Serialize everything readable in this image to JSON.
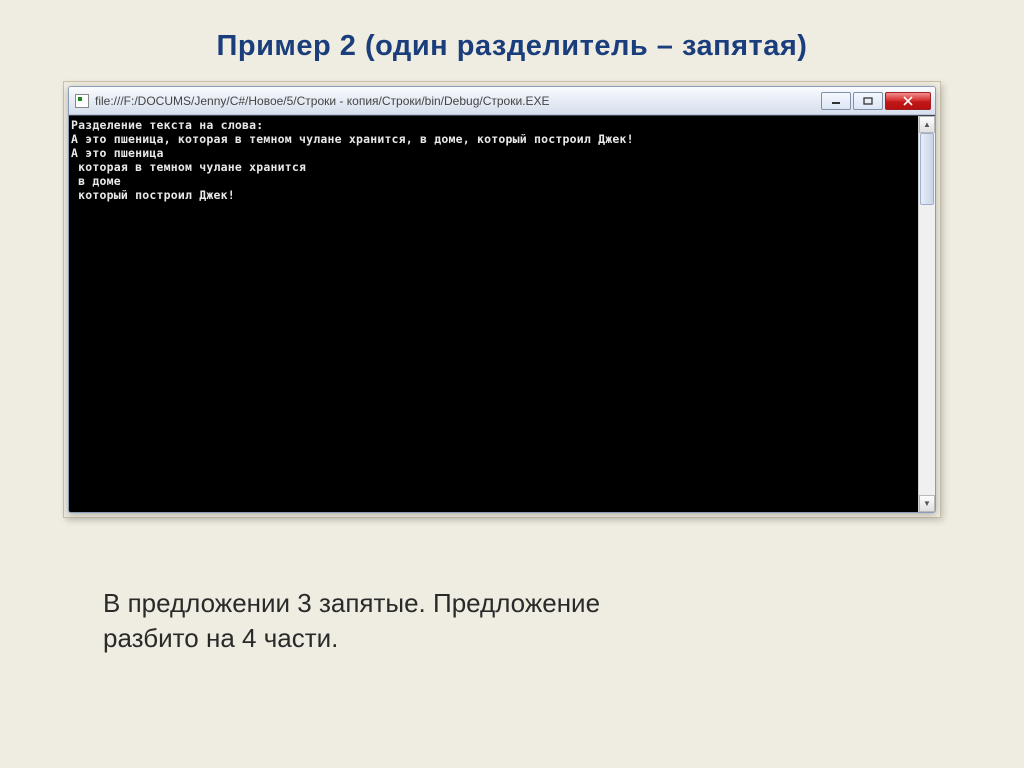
{
  "page": {
    "title": "Пример 2 (один разделитель – запятая)",
    "caption_line1": "В предложении 3 запятые. Предложение",
    "caption_line2": "разбито на 4 части."
  },
  "window": {
    "title": "file:///F:/DOCUMS/Jenny/C#/Новое/5/Строки - копия/Строки/bin/Debug/Строки.EXE"
  },
  "console": {
    "lines": [
      "Разделение текста на слова:",
      "А это пшеница, которая в темном чулане хранится, в доме, который построил Джек!",
      "А это пшеница",
      " которая в темном чулане хранится",
      " в доме",
      " который построил Джек!"
    ]
  },
  "icons": {
    "minimize": "minimize-icon",
    "maximize": "maximize-icon",
    "close": "close-icon",
    "scroll_up": "▲",
    "scroll_down": "▼"
  }
}
